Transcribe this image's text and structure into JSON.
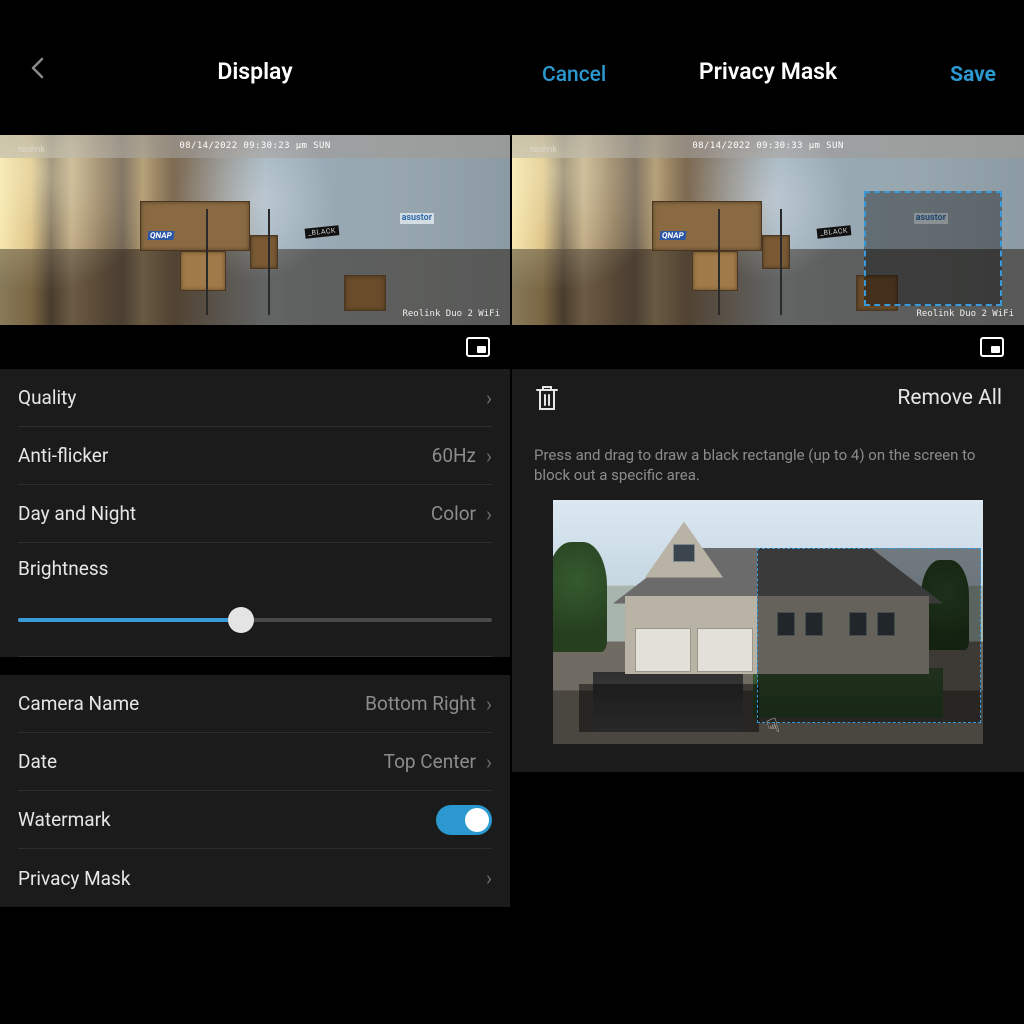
{
  "left": {
    "title": "Display",
    "preview": {
      "timestamp": "08/14/2022 09:30:23 μm SUN",
      "watermark": "reolink",
      "model": "Reolink Duo 2 WiFi",
      "sign_asustor": "asustor",
      "sign_qnap": "QNAP",
      "sign_black": "_BLACK"
    },
    "rows": {
      "quality": {
        "label": "Quality"
      },
      "antiflicker": {
        "label": "Anti-flicker",
        "value": "60Hz"
      },
      "daynight": {
        "label": "Day and Night",
        "value": "Color"
      },
      "brightness": {
        "label": "Brightness",
        "percent": 47
      },
      "camera_name": {
        "label": "Camera Name",
        "value": "Bottom Right"
      },
      "date": {
        "label": "Date",
        "value": "Top Center"
      },
      "watermark": {
        "label": "Watermark",
        "on": true
      },
      "privacy_mask": {
        "label": "Privacy Mask"
      }
    }
  },
  "right": {
    "title": "Privacy Mask",
    "cancel": "Cancel",
    "save": "Save",
    "preview": {
      "timestamp": "08/14/2022 09:30:33 μm SUN",
      "watermark": "reolink",
      "model": "Reolink Duo 2 WiFi",
      "sign_asustor": "asustor",
      "sign_qnap": "QNAP",
      "sign_black": "_BLACK"
    },
    "remove_all": "Remove All",
    "instructions": "Press and drag to draw a black rectangle (up to 4) on the screen to block out a specific area."
  },
  "colors": {
    "accent": "#2b98cf"
  }
}
